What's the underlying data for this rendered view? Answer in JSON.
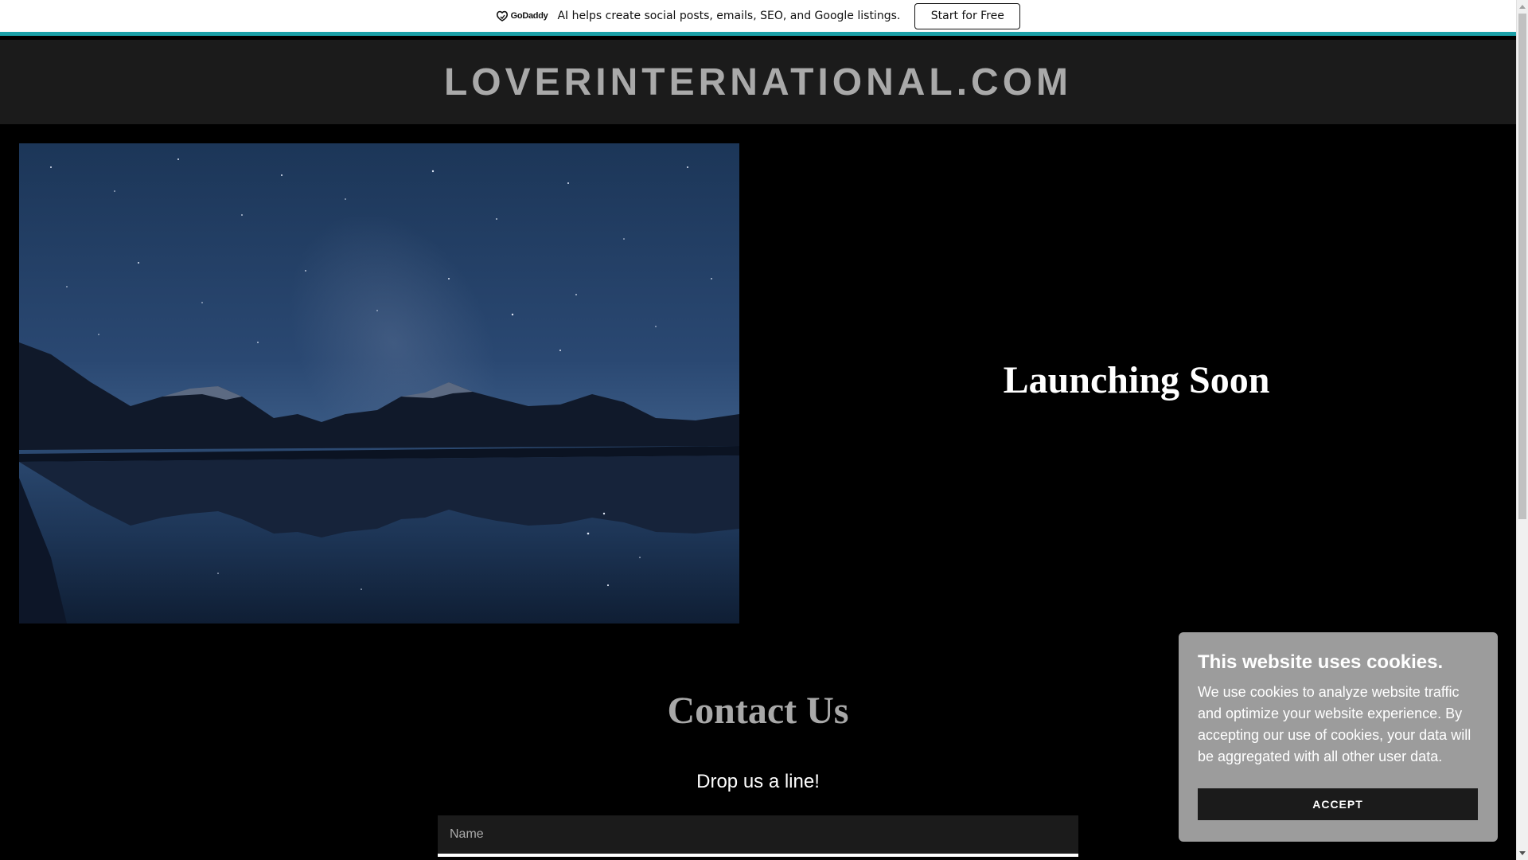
{
  "promo": {
    "logo_text": "GoDaddy",
    "message": "AI helps create social posts, emails, SEO, and Google listings.",
    "button_label": "Start for Free"
  },
  "header": {
    "site_title": "LOVERINTERNATIONAL.COM"
  },
  "hero": {
    "heading": "Launching Soon"
  },
  "contact": {
    "heading": "Contact Us",
    "subheading": "Drop us a line!",
    "name_placeholder": "Name"
  },
  "cookies": {
    "title": "This website uses cookies.",
    "body": "We use cookies to analyze website traffic and optimize your website experience. By accepting our use of cookies, your data will be aggregated with all other user data.",
    "accept_label": "ACCEPT"
  },
  "colors": {
    "promo_accent": "#1ba0a8",
    "header_bg": "#1b1b1b",
    "page_bg": "#000000",
    "cookie_bg": "#9c9c9c"
  }
}
